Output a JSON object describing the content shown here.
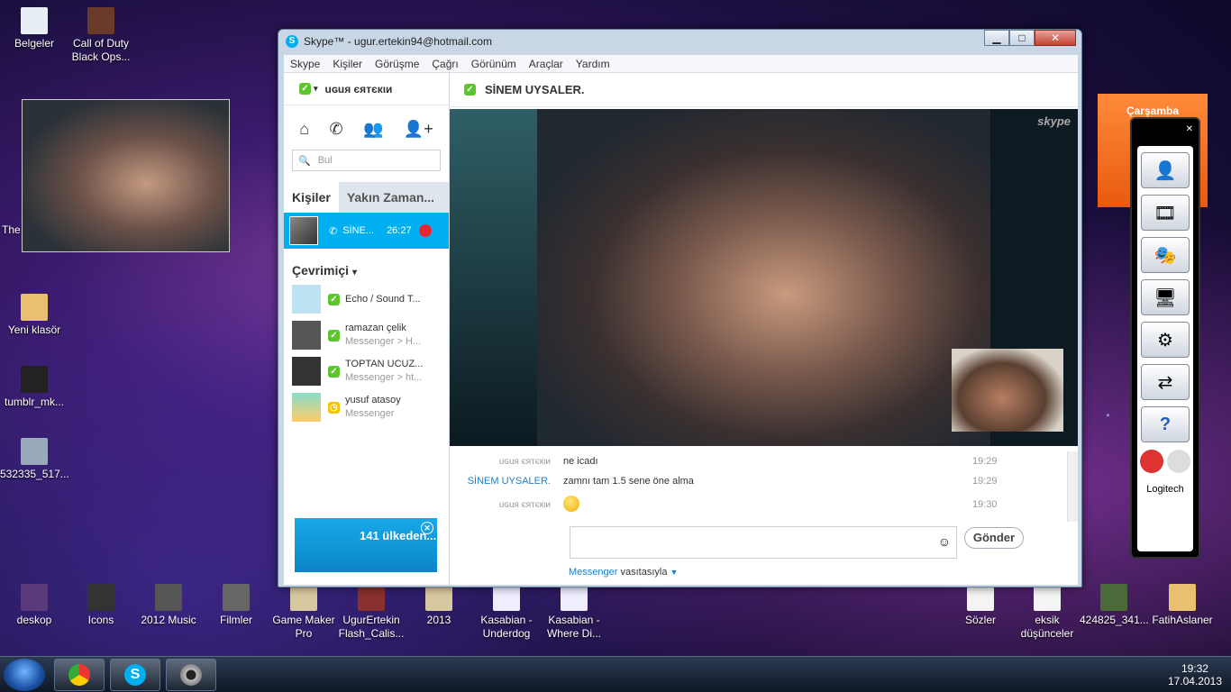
{
  "desktop_icons": [
    {
      "label": "Belgeler",
      "x": 0
    },
    {
      "label": "Call of Duty Black Ops..."
    },
    {
      "label": "The Travelli..."
    },
    {
      "label": "Yeni klasör"
    },
    {
      "label": "tumblr_mk..."
    },
    {
      "label": "532335_517..."
    },
    {
      "label": "deskop"
    },
    {
      "label": "Icons"
    },
    {
      "label": "2012 Music"
    },
    {
      "label": "Filmler"
    },
    {
      "label": "Game Maker Pro"
    },
    {
      "label": "UgurErtekin Flash_Calis..."
    },
    {
      "label": "2013"
    },
    {
      "label": "Kasabian - Underdog"
    },
    {
      "label": "Kasabian - Where Di..."
    },
    {
      "label": "Sözler"
    },
    {
      "label": "eksik düşünceler"
    },
    {
      "label": "424825_341..."
    },
    {
      "label": "FatihAslaner"
    }
  ],
  "window": {
    "title": "Skype™ - ugur.ertekin94@hotmail.com",
    "logo": "S",
    "minimize": "▁",
    "maximize": "□",
    "close": "✕"
  },
  "menu": [
    "Skype",
    "Kişiler",
    "Görüşme",
    "Çağrı",
    "Görünüm",
    "Araçlar",
    "Yardım"
  ],
  "profile": {
    "name": "uɢuя єятєкιи"
  },
  "search": {
    "placeholder": "Bul"
  },
  "tabs": {
    "contacts": "Kişiler",
    "recent": "Yakın Zaman..."
  },
  "active_call": {
    "name": "SİNE...",
    "duration": "26:27"
  },
  "online_section": "Çevrimiçi",
  "contacts": [
    {
      "name": "Echo / Sound T...",
      "sub": "",
      "status": "online"
    },
    {
      "name": "ramazan çelik",
      "sub": "Messenger > H...",
      "status": "online"
    },
    {
      "name": "TOPTAN UCUZ...",
      "sub": "Messenger > ht...",
      "status": "online"
    },
    {
      "name": "yusuf atasoy",
      "sub": "Messenger",
      "status": "away"
    }
  ],
  "ad": {
    "text": "141 ülkeden..."
  },
  "chat_partner": "SİNEM UYSALER.",
  "watermark": "skype",
  "messages": [
    {
      "who": "uɢuя єятєкιи",
      "text": "ne icadı",
      "time": "19:29"
    },
    {
      "who": "SİNEM UYSALER.",
      "text": "zamnı tam 1.5 sene öne alma",
      "time": "19:29"
    },
    {
      "who": "uɢuя єятєкιи",
      "text": "",
      "time": "19:30"
    }
  ],
  "compose": {
    "send": "Gönder",
    "via_service": "Messenger",
    "via_suffix": "vasıtasıyla"
  },
  "calendar": {
    "day": "Çarşamba"
  },
  "logitech": {
    "brand": "Logitech"
  },
  "clock": {
    "time": "19:32",
    "date": "17.04.2013"
  },
  "colors": {
    "skype_blue": "#00aff0",
    "online": "#5cc52e",
    "away": "#f5c400"
  }
}
